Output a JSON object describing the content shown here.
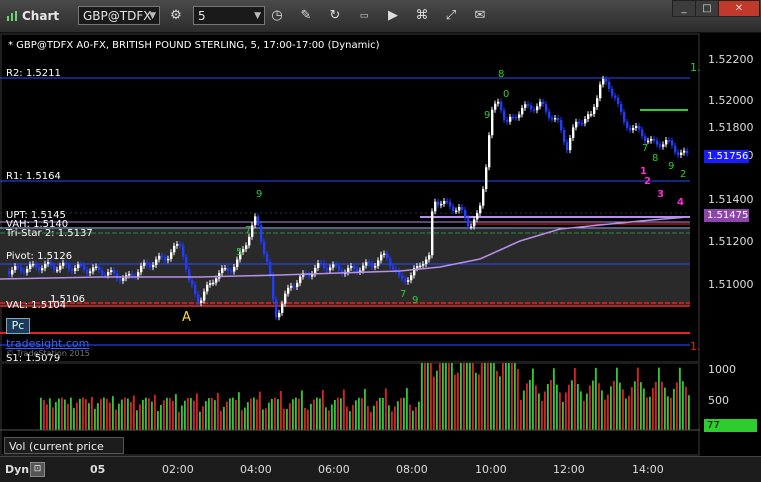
{
  "window": {
    "title": "Chart",
    "symbol_value": "GBP@TDFX",
    "interval_value": "5",
    "minimize": "_",
    "maximize": "□",
    "close": "✕",
    "toolbar_icons": [
      "gear-icon",
      "clock-icon",
      "pencil-icon",
      "refresh-icon",
      "ticker-icon",
      "play-icon",
      "network-icon",
      "chat-icon"
    ]
  },
  "chart": {
    "header": "* GBP@TDFX A0-FX, BRITISH POUND STERLING, 5, 17:00-17:00 (Dynamic)",
    "price_axis": [
      "1.52200",
      "1.52000",
      "1.51800",
      "1.51600",
      "1.51400",
      "1.51200",
      "1.51000"
    ],
    "current_price": "1.51756",
    "ma_price": "1.51475",
    "levels": [
      {
        "label": "R2: 1.5211",
        "color": "#2b4cff"
      },
      {
        "label": "R1: 1.5164",
        "color": "#2b4cff"
      },
      {
        "label": "UPT: 1.5145",
        "color": "#b58fe8"
      },
      {
        "label": "VAH: 1.5140",
        "color": "#b0c0ff"
      },
      {
        "label": "Tri-Star 2: 1.5137",
        "color": "#2e8b3a"
      },
      {
        "label": "Pivot: 1.5126",
        "color": "#2b4cff"
      },
      {
        "label": "1.5106",
        "color": "#e82020"
      },
      {
        "label": "VAL: 1.5104",
        "color": "#e82020"
      },
      {
        "label": "S1: 1.5079",
        "color": "#2b4cff"
      }
    ],
    "right_edge_markers": [
      "1.",
      "1."
    ],
    "point_marker": "A",
    "count_labels": [
      "1",
      "2",
      "3",
      "4"
    ],
    "pc_button": "Pc",
    "watermark": "tradesight.com",
    "watermark_sub": "© TradeStation 2015"
  },
  "volume": {
    "axis": [
      "1000",
      "500"
    ],
    "current_value": "77",
    "label": "Vol (current price bar)"
  },
  "time_axis": {
    "mode": "Dyn",
    "labels": [
      "05",
      "02:00",
      "04:00",
      "06:00",
      "08:00",
      "10:00",
      "12:00",
      "14:00"
    ]
  },
  "colors": {
    "up_bar": "#ffffff",
    "down_bar": "#1f3cff",
    "ma_line": "#b58fe8",
    "tag_blue": "#1a1aff",
    "tag_green": "#2ecc2e"
  }
}
